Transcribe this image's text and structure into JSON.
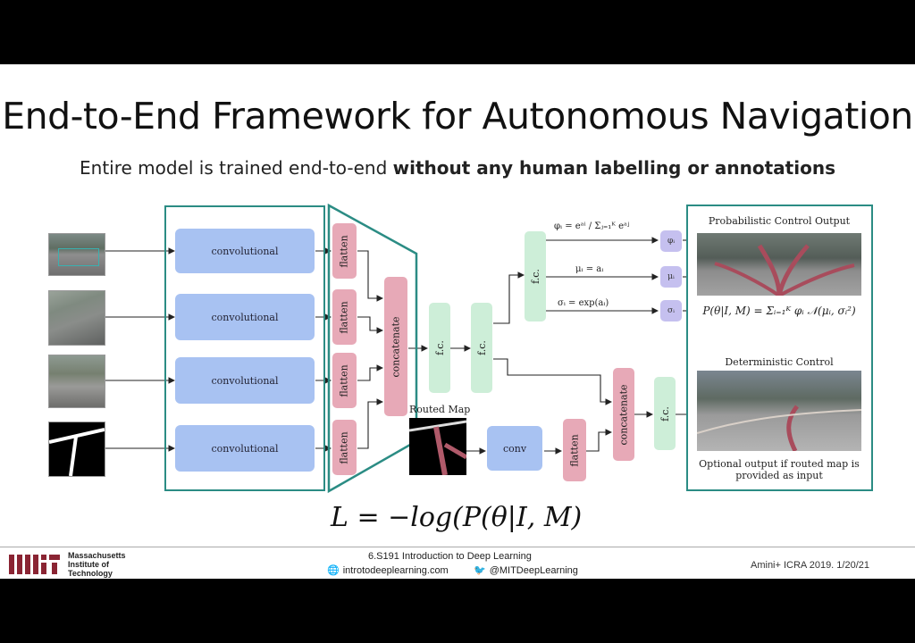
{
  "slide": {
    "title": "End-to-End Framework for Autonomous Navigation",
    "subtitle_prefix": "Entire model is trained end-to-end ",
    "subtitle_bold": "without any human labelling or annotations"
  },
  "diagram": {
    "conv_label": "convolutional",
    "flatten_label": "flatten",
    "concat_label": "concatenate",
    "fc_label": "f.c.",
    "conv_small_label": "conv",
    "routed_map_label": "Routed Map",
    "phi_eq": "φᵢ = eᵃⁱ / Σⱼ₌₁ᴷ eᵃʲ",
    "mu_eq": "μᵢ = aᵢ",
    "sigma_eq": "σᵢ = exp(aᵢ)",
    "out_phi": "φᵢ",
    "out_mu": "μᵢ",
    "out_sigma": "σᵢ",
    "prob_control_title": "Probabilistic Control Output",
    "prob_formula": "P(θ|I, M) = Σᵢ₌₁ᴷ φᵢ 𝒩(μᵢ, σᵢ²)",
    "det_control_title": "Deterministic Control",
    "optional_output": "Optional output if routed map is provided as input",
    "loss": "L = −log(P(θ|I, M)"
  },
  "footer": {
    "org1": "Massachusetts",
    "org2": "Institute of",
    "org3": "Technology",
    "course": "6.S191 Introduction to Deep Learning",
    "website": "introtodeeplearning.com",
    "twitter": "@MITDeepLearning",
    "citation": "Amini+ ICRA 2019. 1/20/21"
  },
  "colors": {
    "teal": "#2b8c84",
    "blue_block": "#a8c2f2",
    "pink_block": "#e7a9b7",
    "green_block": "#cdeed8",
    "purple_block": "#c5c0ef"
  }
}
